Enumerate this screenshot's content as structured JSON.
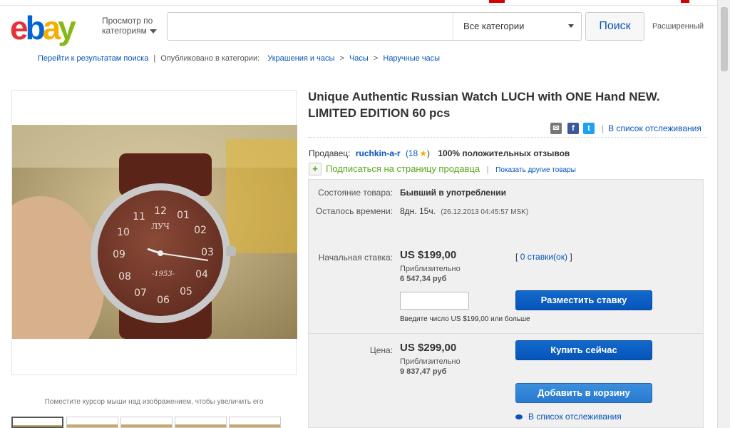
{
  "header": {
    "logo_letters": [
      "e",
      "b",
      "a",
      "y"
    ],
    "browse_label": "Просмотр по категориям",
    "search_value": "",
    "category_selected": "Все категории",
    "search_button": "Поиск",
    "advanced_link": "Расширенный"
  },
  "breadcrumb": {
    "back_link": "Перейти к результатам поиска",
    "published_label": "Опубликовано в категории:",
    "items": [
      "Украшения и часы",
      "Часы",
      "Наручные часы"
    ]
  },
  "gallery": {
    "zoom_hint": "Поместите курсор мыши над изображением, чтобы увеличить его",
    "dial_numbers": [
      "12",
      "01",
      "02",
      "03",
      "04",
      "05",
      "06",
      "07",
      "08",
      "09",
      "10",
      "11"
    ],
    "dial_year": "-1953-",
    "dial_brand": "ЛУЧ"
  },
  "item": {
    "title": "Unique Authentic Russian Watch LUCH with ONE Hand NEW. LIMITED EDITION 60 pcs",
    "watch_link": "В список отслеживания",
    "seller_label": "Продавец:",
    "seller_name": "ruchkin-a-r",
    "seller_score": "(18",
    "seller_score_close": ")",
    "seller_positive": "100% положительных отзывов",
    "subscribe_label": "Подписаться на страницу продавца",
    "other_items_link": "Показать другие товары"
  },
  "bid": {
    "condition_label": "Состояние товара:",
    "condition_value": "Бывший в употреблении",
    "time_left_label": "Осталось времени:",
    "time_left_value": "8дн. 15ч.",
    "time_left_date": "(26.12.2013   04:45:57 MSK)",
    "starting_bid_label": "Начальная ставка:",
    "starting_bid_price": "US $199,00",
    "approx_label": "Приблизительно",
    "starting_bid_rub": "6 547,34 руб",
    "bid_count_open": "[",
    "bid_count_link": "0 ставки(ок)",
    "bid_count_close": "]",
    "bid_input_value": "",
    "place_bid_button": "Разместить ставку",
    "bid_hint": "Введите число US $199,00 или больше",
    "price_label": "Цена:",
    "buy_price": "US $299,00",
    "buy_price_rub": "9 837,47 руб",
    "buy_now_button": "Купить сейчас",
    "add_to_cart_button": "Добавить в корзину",
    "watch_link_bottom": "В список отслеживания"
  }
}
